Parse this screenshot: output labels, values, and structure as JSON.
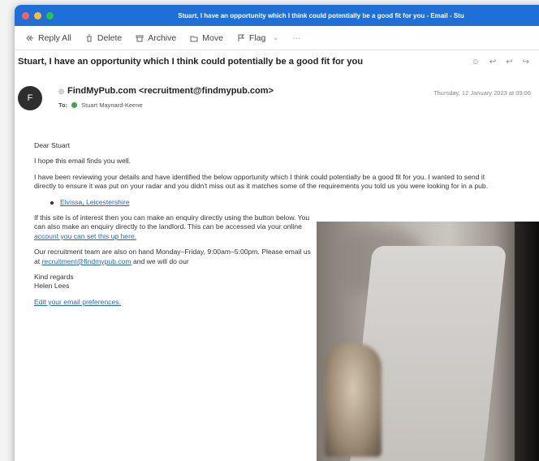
{
  "window": {
    "title": "Stuart, I have an opportunity which I think could potentially be a good fit for you - Email - Stu",
    "traffic_colors": [
      "#ff5f57",
      "#febc2e",
      "#28c840"
    ]
  },
  "toolbar": {
    "reply_all": "Reply All",
    "delete": "Delete",
    "archive": "Archive",
    "move": "Move",
    "flag": "Flag",
    "more": "···"
  },
  "email": {
    "subject": "Stuart, I have an opportunity which I think could potentially be a good fit for you",
    "avatar_letter": "F",
    "from": "FindMyPub.com <recruitment@findmypub.com>",
    "to_label": "To:",
    "to": "Stuart Maynard-Keene",
    "date": "Thursday, 12 January 2023 at 09:06",
    "greeting": "Dear Stuart",
    "p1": "I hope this email finds you well.",
    "p2": "I have been reviewing your details and have identified the below opportunity which I think could potentially be a good fit for you. I wanted to send it directly to ensure it was put on your radar and you didn't miss out as it matches some of the requirements you told us you were looking for in a pub.",
    "bullet_link": "Elvissa, Leicestershire",
    "p3": "If this site is of interest then you can make an enquiry directly using the button below. You can also make an enquiry directly to the landlord. This can be accessed via your online",
    "p3_link": "account you can set this up here.",
    "p4": "Our recruitment team are also on hand Monday–Friday, 9:00am–5:00pm. Please email us at",
    "p4_link": "recruitment@findmypub.com",
    "p4_tail": " and we will do our",
    "sign1": "Kind regards",
    "sign2": "Helen Lees",
    "prefs_link": "Edit your email preferences."
  }
}
